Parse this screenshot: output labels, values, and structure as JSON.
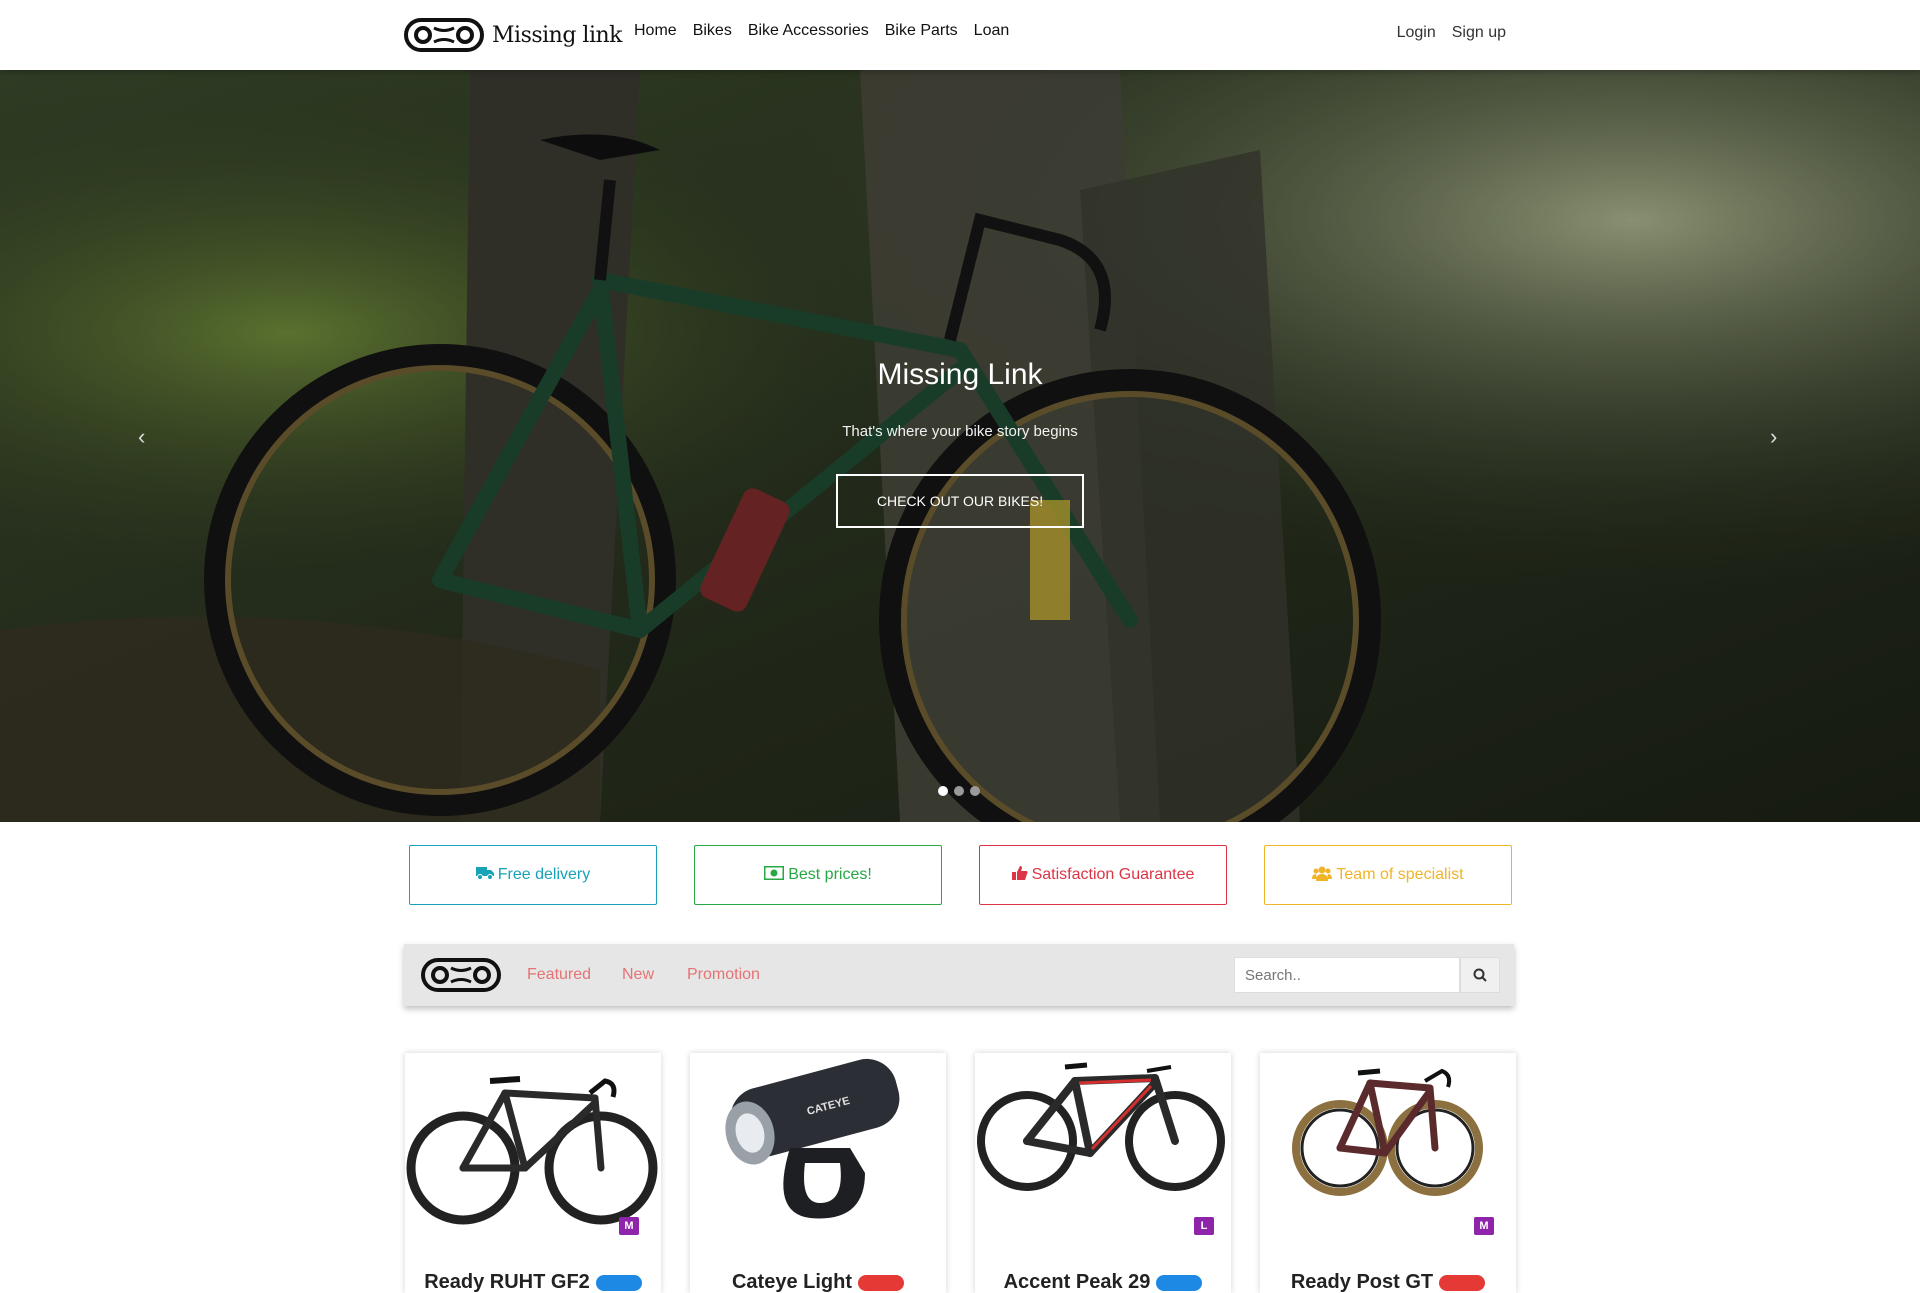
{
  "nav": {
    "brand": "Missing link",
    "links": [
      "Home",
      "Bikes",
      "Bike Accessories",
      "Bike Parts",
      "Loan"
    ],
    "login": "Login",
    "signup": "Sign up"
  },
  "hero": {
    "title": "Missing Link",
    "subtitle": "That's where your bike story begins",
    "button": "CHECK OUT OUR BIKES!",
    "prev_icon": "chevron-left-icon",
    "next_icon": "chevron-right-icon",
    "slides": 3,
    "active_slide": 1
  },
  "features": [
    {
      "label": "Free delivery",
      "icon": "truck-icon",
      "color": "#17a2b8"
    },
    {
      "label": "Best prices!",
      "icon": "money-icon",
      "color": "#28a745"
    },
    {
      "label": "Satisfaction Guarantee",
      "icon": "thumbs-up-icon",
      "color": "#dc3545"
    },
    {
      "label": "Team of specialist",
      "icon": "users-icon",
      "color": "#f0b429"
    }
  ],
  "filter": {
    "tabs": [
      "Featured",
      "New",
      "Promotion"
    ],
    "search_placeholder": "Search..",
    "search_icon": "search-icon"
  },
  "products": [
    {
      "name": "Ready RUHT GF2",
      "size": "M",
      "tag_color": "#1e88e5"
    },
    {
      "name": "Cateye Light",
      "size": "",
      "tag_color": "#e53935"
    },
    {
      "name": "Accent Peak 29",
      "size": "L",
      "tag_color": "#1e88e5"
    },
    {
      "name": "Ready Post GT",
      "size": "M",
      "tag_color": "#e53935"
    }
  ],
  "colors": {
    "accent": "#e57373",
    "badge": "#8e24aa"
  }
}
